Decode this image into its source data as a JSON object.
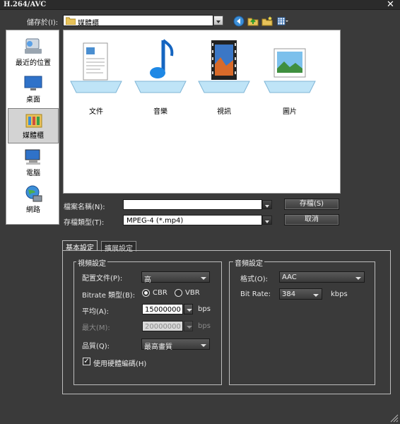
{
  "window": {
    "title": "H.264/AVC"
  },
  "save_in": {
    "label": "儲存於(I):",
    "value": "媒體櫃"
  },
  "toolbar": {
    "icons": [
      "back-icon",
      "up-folder-icon",
      "new-folder-icon",
      "view-menu-icon"
    ]
  },
  "places": [
    {
      "label": "最近的位置",
      "icon": "recent-places-icon"
    },
    {
      "label": "桌面",
      "icon": "desktop-icon"
    },
    {
      "label": "媒體櫃",
      "icon": "libraries-icon",
      "selected": true
    },
    {
      "label": "電腦",
      "icon": "computer-icon"
    },
    {
      "label": "網路",
      "icon": "network-icon"
    }
  ],
  "folders": [
    {
      "label": "文件",
      "icon": "documents-library-icon"
    },
    {
      "label": "音樂",
      "icon": "music-library-icon"
    },
    {
      "label": "視訊",
      "icon": "videos-library-icon"
    },
    {
      "label": "圖片",
      "icon": "pictures-library-icon"
    }
  ],
  "file_name": {
    "label": "檔案名稱(N):",
    "value": ""
  },
  "file_type": {
    "label": "存檔類型(T):",
    "value": "MPEG-4 (*.mp4)"
  },
  "buttons": {
    "save": "存檔(S)",
    "cancel": "取消"
  },
  "tabs": [
    {
      "label": "基本設定",
      "active": true
    },
    {
      "label": "擴展設定",
      "active": false
    }
  ],
  "video": {
    "title": "視頻設定",
    "profile": {
      "label": "配置文件(P):",
      "value": "高"
    },
    "bitrate_type": {
      "label": "Bitrate 類型(B):",
      "cbr": "CBR",
      "vbr": "VBR",
      "selected": "CBR"
    },
    "average": {
      "label": "平均(A):",
      "value": "15000000",
      "unit": "bps"
    },
    "max": {
      "label": "最大(M):",
      "value": "20000000",
      "unit": "bps",
      "enabled": false
    },
    "quality": {
      "label": "品質(Q):",
      "value": "最高畫質"
    },
    "hw_encode": {
      "label": "使用硬體編碼(H)",
      "checked": true
    }
  },
  "audio": {
    "title": "音頻設定",
    "format": {
      "label": "格式(O):",
      "value": "AAC"
    },
    "bitrate": {
      "label": "Bit Rate:",
      "value": "384",
      "unit": "kbps"
    }
  }
}
